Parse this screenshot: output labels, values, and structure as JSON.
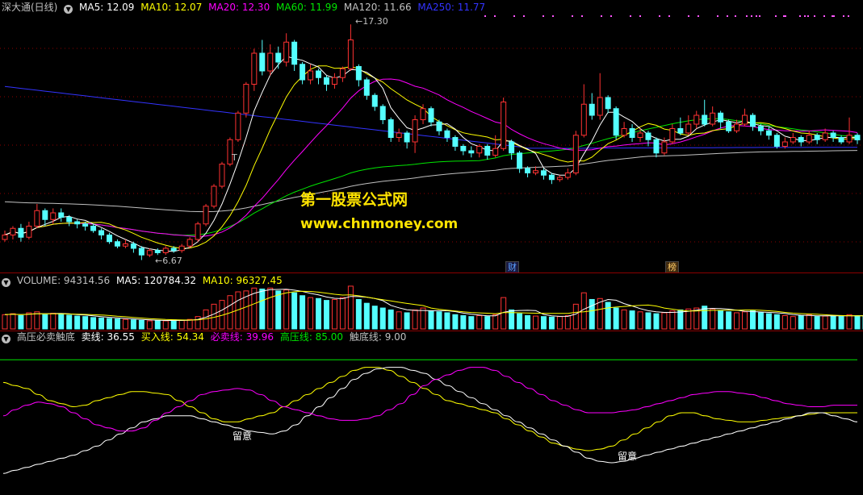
{
  "price_header": {
    "name": "深大通(日线)",
    "ma5": "MA5: 12.09",
    "ma10": "MA10: 12.07",
    "ma20": "MA20: 12.30",
    "ma60": "MA60: 11.99",
    "ma120": "MA120: 11.66",
    "ma250": "MA250: 11.77"
  },
  "price_annotations": {
    "high": "17.30",
    "low": "6.67",
    "t_marker": "T"
  },
  "badges": {
    "b1": "财",
    "b2": "榜"
  },
  "watermark": {
    "line1": "第一股票公式网",
    "line2": "www.chnmoney.com"
  },
  "volume_header": {
    "label": "VOLUME: 94314.56",
    "ma5": "MA5: 120784.32",
    "ma10": "MA10: 96327.45"
  },
  "indicator_header": {
    "name": "高压必卖触底",
    "sell": "卖线: 36.55",
    "buy": "买入线: 54.34",
    "must_sell": "必卖线: 39.96",
    "high_pressure": "高压线: 85.00",
    "bottom": "触底线: 9.00"
  },
  "indicator_labels": {
    "l1": "留意",
    "l2": "留意"
  },
  "colors": {
    "up": "#ff3232",
    "down": "#54ffff",
    "ma5": "#ffffff",
    "ma10": "#ffff00",
    "ma20": "#ff00ff",
    "ma60": "#00e600",
    "ma120": "#c0c0c0",
    "ma250": "#3333ff",
    "grid": "#8b0000"
  },
  "chart_data": {
    "type": "candlestick",
    "price_range": [
      6.67,
      17.3
    ],
    "candles": [
      {
        "o": 7.6,
        "c": 7.8,
        "h": 8.0,
        "l": 7.5
      },
      {
        "o": 7.8,
        "c": 8.1,
        "h": 8.2,
        "l": 7.6
      },
      {
        "o": 8.1,
        "c": 7.7,
        "h": 8.3,
        "l": 7.5
      },
      {
        "o": 7.7,
        "c": 8.2,
        "h": 8.4,
        "l": 7.6
      },
      {
        "o": 8.2,
        "c": 8.9,
        "h": 9.2,
        "l": 8.1
      },
      {
        "o": 8.9,
        "c": 8.5,
        "h": 9.0,
        "l": 8.2
      },
      {
        "o": 8.5,
        "c": 8.8,
        "h": 9.0,
        "l": 8.3
      },
      {
        "o": 8.8,
        "c": 8.6,
        "h": 9.0,
        "l": 8.4
      },
      {
        "o": 8.6,
        "c": 8.4,
        "h": 8.7,
        "l": 8.2
      },
      {
        "o": 8.4,
        "c": 8.3,
        "h": 8.5,
        "l": 8.1
      },
      {
        "o": 8.3,
        "c": 8.2,
        "h": 8.4,
        "l": 8.0
      },
      {
        "o": 8.2,
        "c": 8.0,
        "h": 8.3,
        "l": 7.9
      },
      {
        "o": 8.0,
        "c": 7.8,
        "h": 8.1,
        "l": 7.6
      },
      {
        "o": 7.8,
        "c": 7.5,
        "h": 7.9,
        "l": 7.4
      },
      {
        "o": 7.5,
        "c": 7.3,
        "h": 7.6,
        "l": 7.2
      },
      {
        "o": 7.3,
        "c": 7.4,
        "h": 7.6,
        "l": 7.2
      },
      {
        "o": 7.4,
        "c": 7.2,
        "h": 7.5,
        "l": 7.0
      },
      {
        "o": 7.2,
        "c": 6.9,
        "h": 7.3,
        "l": 6.67
      },
      {
        "o": 6.9,
        "c": 7.1,
        "h": 7.2,
        "l": 6.8
      },
      {
        "o": 7.1,
        "c": 7.0,
        "h": 7.2,
        "l": 6.9
      },
      {
        "o": 7.0,
        "c": 7.2,
        "h": 7.3,
        "l": 6.9
      },
      {
        "o": 7.2,
        "c": 7.1,
        "h": 7.3,
        "l": 7.0
      },
      {
        "o": 7.1,
        "c": 7.3,
        "h": 7.4,
        "l": 7.0
      },
      {
        "o": 7.3,
        "c": 7.6,
        "h": 7.7,
        "l": 7.2
      },
      {
        "o": 7.6,
        "c": 8.3,
        "h": 8.4,
        "l": 7.5
      },
      {
        "o": 8.3,
        "c": 9.1,
        "h": 9.2,
        "l": 8.2
      },
      {
        "o": 9.1,
        "c": 10.0,
        "h": 10.1,
        "l": 9.0
      },
      {
        "o": 10.0,
        "c": 11.0,
        "h": 11.1,
        "l": 9.9
      },
      {
        "o": 11.0,
        "c": 12.1,
        "h": 12.2,
        "l": 10.9
      },
      {
        "o": 12.1,
        "c": 13.3,
        "h": 13.4,
        "l": 12.0
      },
      {
        "o": 13.3,
        "c": 14.6,
        "h": 14.7,
        "l": 13.1
      },
      {
        "o": 14.6,
        "c": 16.0,
        "h": 16.2,
        "l": 14.3
      },
      {
        "o": 16.0,
        "c": 15.2,
        "h": 16.6,
        "l": 15.0
      },
      {
        "o": 15.2,
        "c": 16.0,
        "h": 16.4,
        "l": 15.0
      },
      {
        "o": 16.0,
        "c": 15.6,
        "h": 16.3,
        "l": 15.3
      },
      {
        "o": 15.6,
        "c": 16.5,
        "h": 16.9,
        "l": 15.4
      },
      {
        "o": 16.5,
        "c": 15.5,
        "h": 16.6,
        "l": 15.2
      },
      {
        "o": 15.5,
        "c": 14.8,
        "h": 15.6,
        "l": 14.6
      },
      {
        "o": 14.8,
        "c": 15.2,
        "h": 15.5,
        "l": 14.6
      },
      {
        "o": 15.2,
        "c": 14.9,
        "h": 15.3,
        "l": 14.6
      },
      {
        "o": 14.9,
        "c": 14.6,
        "h": 15.0,
        "l": 14.3
      },
      {
        "o": 14.6,
        "c": 14.9,
        "h": 15.1,
        "l": 14.4
      },
      {
        "o": 14.9,
        "c": 15.3,
        "h": 15.4,
        "l": 14.7
      },
      {
        "o": 15.3,
        "c": 16.6,
        "h": 17.3,
        "l": 15.2
      },
      {
        "o": 15.4,
        "c": 14.8,
        "h": 15.5,
        "l": 14.5
      },
      {
        "o": 14.8,
        "c": 14.1,
        "h": 14.9,
        "l": 13.9
      },
      {
        "o": 14.1,
        "c": 13.6,
        "h": 14.2,
        "l": 13.4
      },
      {
        "o": 13.6,
        "c": 13.0,
        "h": 13.7,
        "l": 12.8
      },
      {
        "o": 13.0,
        "c": 12.2,
        "h": 13.1,
        "l": 12.0
      },
      {
        "o": 12.2,
        "c": 12.4,
        "h": 12.6,
        "l": 12.0
      },
      {
        "o": 12.4,
        "c": 12.0,
        "h": 12.5,
        "l": 11.7
      },
      {
        "o": 12.0,
        "c": 13.0,
        "h": 13.2,
        "l": 11.5
      },
      {
        "o": 13.0,
        "c": 13.5,
        "h": 13.7,
        "l": 12.8
      },
      {
        "o": 13.5,
        "c": 12.9,
        "h": 13.6,
        "l": 12.7
      },
      {
        "o": 12.9,
        "c": 12.5,
        "h": 13.0,
        "l": 12.3
      },
      {
        "o": 12.5,
        "c": 12.2,
        "h": 12.6,
        "l": 12.0
      },
      {
        "o": 12.2,
        "c": 11.8,
        "h": 12.3,
        "l": 11.6
      },
      {
        "o": 11.8,
        "c": 11.6,
        "h": 11.9,
        "l": 11.4
      },
      {
        "o": 11.6,
        "c": 11.5,
        "h": 11.8,
        "l": 11.3
      },
      {
        "o": 11.5,
        "c": 11.8,
        "h": 11.9,
        "l": 11.3
      },
      {
        "o": 11.8,
        "c": 11.4,
        "h": 11.9,
        "l": 11.2
      },
      {
        "o": 11.4,
        "c": 11.7,
        "h": 12.3,
        "l": 11.3
      },
      {
        "o": 11.7,
        "c": 13.8,
        "h": 14.0,
        "l": 11.6
      },
      {
        "o": 12.0,
        "c": 11.5,
        "h": 12.1,
        "l": 11.2
      },
      {
        "o": 11.5,
        "c": 10.8,
        "h": 11.6,
        "l": 10.6
      },
      {
        "o": 10.8,
        "c": 10.6,
        "h": 10.9,
        "l": 10.4
      },
      {
        "o": 10.6,
        "c": 10.7,
        "h": 10.9,
        "l": 10.5
      },
      {
        "o": 10.7,
        "c": 10.5,
        "h": 10.8,
        "l": 10.3
      },
      {
        "o": 10.5,
        "c": 10.3,
        "h": 10.6,
        "l": 10.1
      },
      {
        "o": 10.3,
        "c": 10.4,
        "h": 10.5,
        "l": 10.2
      },
      {
        "o": 10.4,
        "c": 10.6,
        "h": 10.8,
        "l": 10.3
      },
      {
        "o": 10.6,
        "c": 12.3,
        "h": 12.5,
        "l": 10.5
      },
      {
        "o": 12.3,
        "c": 13.7,
        "h": 14.6,
        "l": 12.2
      },
      {
        "o": 13.7,
        "c": 13.2,
        "h": 14.2,
        "l": 13.0
      },
      {
        "o": 13.2,
        "c": 14.0,
        "h": 15.1,
        "l": 13.0
      },
      {
        "o": 14.0,
        "c": 13.5,
        "h": 14.1,
        "l": 13.3
      },
      {
        "o": 13.5,
        "c": 12.3,
        "h": 13.6,
        "l": 12.1
      },
      {
        "o": 12.3,
        "c": 12.6,
        "h": 12.9,
        "l": 12.2
      },
      {
        "o": 12.6,
        "c": 12.2,
        "h": 12.8,
        "l": 12.0
      },
      {
        "o": 12.2,
        "c": 12.4,
        "h": 12.6,
        "l": 12.0
      },
      {
        "o": 12.4,
        "c": 12.1,
        "h": 12.5,
        "l": 11.8
      },
      {
        "o": 12.1,
        "c": 11.5,
        "h": 12.2,
        "l": 11.3
      },
      {
        "o": 11.5,
        "c": 12.0,
        "h": 12.2,
        "l": 11.4
      },
      {
        "o": 12.0,
        "c": 12.6,
        "h": 12.8,
        "l": 11.9
      },
      {
        "o": 12.6,
        "c": 12.4,
        "h": 13.1,
        "l": 12.3
      },
      {
        "o": 12.4,
        "c": 12.8,
        "h": 13.2,
        "l": 12.3
      },
      {
        "o": 12.8,
        "c": 13.2,
        "h": 13.4,
        "l": 12.6
      },
      {
        "o": 13.2,
        "c": 12.8,
        "h": 13.9,
        "l": 12.7
      },
      {
        "o": 12.8,
        "c": 13.3,
        "h": 13.6,
        "l": 12.7
      },
      {
        "o": 13.3,
        "c": 12.9,
        "h": 13.4,
        "l": 12.6
      },
      {
        "o": 12.9,
        "c": 12.5,
        "h": 13.0,
        "l": 12.4
      },
      {
        "o": 12.5,
        "c": 12.8,
        "h": 13.0,
        "l": 12.4
      },
      {
        "o": 12.8,
        "c": 13.2,
        "h": 13.5,
        "l": 12.7
      },
      {
        "o": 13.2,
        "c": 12.7,
        "h": 13.3,
        "l": 12.5
      },
      {
        "o": 12.7,
        "c": 12.5,
        "h": 12.8,
        "l": 12.3
      },
      {
        "o": 12.5,
        "c": 12.3,
        "h": 12.7,
        "l": 12.1
      },
      {
        "o": 12.3,
        "c": 11.8,
        "h": 12.4,
        "l": 11.7
      },
      {
        "o": 11.8,
        "c": 12.0,
        "h": 12.2,
        "l": 11.7
      },
      {
        "o": 12.0,
        "c": 12.2,
        "h": 12.4,
        "l": 11.9
      },
      {
        "o": 12.2,
        "c": 12.0,
        "h": 12.3,
        "l": 11.8
      },
      {
        "o": 12.0,
        "c": 12.3,
        "h": 12.5,
        "l": 11.9
      },
      {
        "o": 12.3,
        "c": 12.1,
        "h": 12.4,
        "l": 11.9
      },
      {
        "o": 12.1,
        "c": 12.4,
        "h": 12.6,
        "l": 12.0
      },
      {
        "o": 12.4,
        "c": 12.2,
        "h": 12.5,
        "l": 12.0
      },
      {
        "o": 12.2,
        "c": 12.0,
        "h": 12.3,
        "l": 11.9
      },
      {
        "o": 12.0,
        "c": 12.3,
        "h": 13.1,
        "l": 11.9
      },
      {
        "o": 12.3,
        "c": 12.09,
        "h": 12.4,
        "l": 11.9
      }
    ],
    "volume": [
      30,
      32,
      28,
      34,
      36,
      30,
      33,
      31,
      29,
      27,
      26,
      24,
      23,
      22,
      21,
      20,
      19,
      18,
      17,
      18,
      17,
      19,
      18,
      20,
      26,
      40,
      52,
      60,
      70,
      78,
      80,
      86,
      84,
      86,
      80,
      82,
      76,
      70,
      66,
      64,
      60,
      62,
      66,
      90,
      62,
      54,
      48,
      44,
      40,
      36,
      34,
      40,
      44,
      38,
      36,
      34,
      30,
      28,
      26,
      28,
      26,
      30,
      66,
      40,
      32,
      28,
      27,
      26,
      25,
      26,
      28,
      52,
      76,
      62,
      64,
      56,
      44,
      40,
      38,
      36,
      34,
      32,
      34,
      38,
      40,
      42,
      44,
      48,
      42,
      38,
      36,
      34,
      36,
      38,
      34,
      32,
      30,
      28,
      26,
      28,
      30,
      26,
      27,
      28,
      26,
      30,
      28,
      27,
      26,
      28,
      25
    ],
    "indicator": {
      "sell_line": [
        48,
        52,
        55,
        57,
        56,
        54,
        50,
        46,
        42,
        40,
        38,
        38,
        40,
        45,
        50,
        54,
        58,
        62,
        64,
        65,
        66,
        65,
        62,
        58,
        54,
        52,
        50,
        48,
        46,
        45,
        45,
        46,
        48,
        52,
        56,
        62,
        68,
        72,
        75,
        78,
        80,
        80,
        78,
        74,
        70,
        66,
        62,
        58,
        55,
        52,
        50,
        50,
        50,
        51,
        52,
        54,
        56,
        58,
        60,
        62,
        63,
        64,
        64,
        63,
        62,
        60,
        58,
        56,
        55,
        54,
        54,
        55,
        55,
        55
      ],
      "buy_line": [
        70,
        68,
        66,
        62,
        58,
        56,
        54,
        55,
        58,
        60,
        62,
        64,
        64,
        63,
        62,
        58,
        54,
        50,
        46,
        44,
        44,
        46,
        48,
        50,
        54,
        58,
        62,
        66,
        70,
        74,
        78,
        80,
        80,
        78,
        74,
        70,
        66,
        62,
        58,
        56,
        54,
        52,
        50,
        46,
        42,
        38,
        34,
        30,
        28,
        26,
        25,
        26,
        28,
        32,
        36,
        40,
        44,
        48,
        50,
        50,
        48,
        46,
        45,
        44,
        44,
        45,
        46,
        47,
        48,
        49,
        50,
        50,
        50,
        50
      ],
      "must_sell_line": [
        10,
        12,
        14,
        16,
        18,
        20,
        22,
        25,
        28,
        32,
        36,
        40,
        44,
        46,
        48,
        48,
        48,
        46,
        44,
        42,
        40,
        38,
        37,
        36,
        38,
        42,
        48,
        54,
        60,
        66,
        72,
        76,
        79,
        80,
        80,
        78,
        76,
        72,
        68,
        64,
        60,
        56,
        52,
        48,
        44,
        40,
        36,
        32,
        28,
        24,
        20,
        18,
        17,
        18,
        20,
        22,
        24,
        26,
        28,
        30,
        32,
        34,
        36,
        38,
        40,
        42,
        44,
        46,
        48,
        50,
        50,
        48,
        46,
        44
      ],
      "high_pressure": 85.0,
      "bottom": 9.0
    }
  }
}
